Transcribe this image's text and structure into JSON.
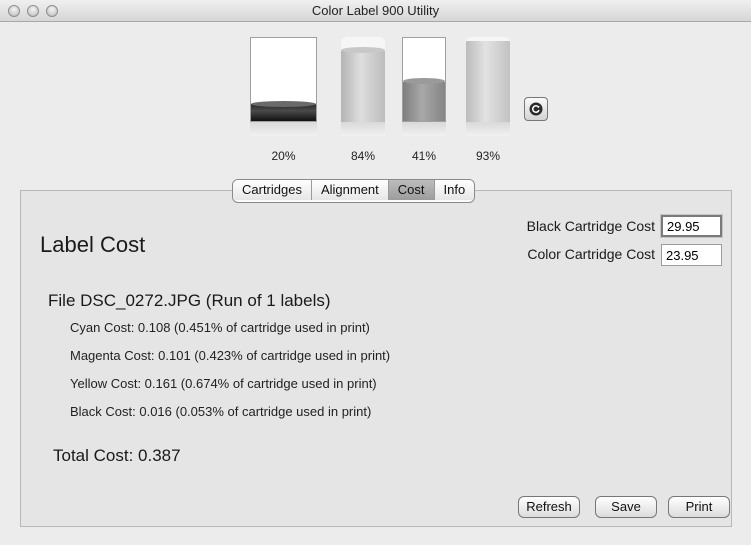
{
  "window": {
    "title": "Color Label 900 Utility"
  },
  "cartridges": [
    {
      "name": "black",
      "level_percent": 20,
      "label": "20%"
    },
    {
      "name": "cyan",
      "level_percent": 84,
      "label": "84%"
    },
    {
      "name": "magenta",
      "level_percent": 41,
      "label": "41%"
    },
    {
      "name": "yellow",
      "level_percent": 93,
      "label": "93%"
    }
  ],
  "tabs": [
    {
      "label": "Cartridges",
      "active": false
    },
    {
      "label": "Alignment",
      "active": false
    },
    {
      "label": "Cost",
      "active": true
    },
    {
      "label": "Info",
      "active": false
    }
  ],
  "cost": {
    "heading": "Label Cost",
    "black_cartridge_label": "Black Cartridge Cost",
    "black_cartridge_value": "29.95",
    "color_cartridge_label": "Color Cartridge Cost",
    "color_cartridge_value": "23.95",
    "file_line": "File DSC_0272.JPG (Run of 1 labels)",
    "details": [
      "Cyan Cost:  0.108 (0.451% of cartridge used in print)",
      "Magenta Cost:  0.101 (0.423% of cartridge used in print)",
      "Yellow Cost:  0.161 (0.674% of cartridge used in print)",
      "Black Cost:  0.016 (0.053% of cartridge used in print)"
    ],
    "total": "Total Cost:  0.387"
  },
  "buttons": {
    "refresh": "Refresh",
    "save": "Save",
    "print": "Print"
  },
  "icons": {
    "refresh_levels": "refresh-icon"
  }
}
